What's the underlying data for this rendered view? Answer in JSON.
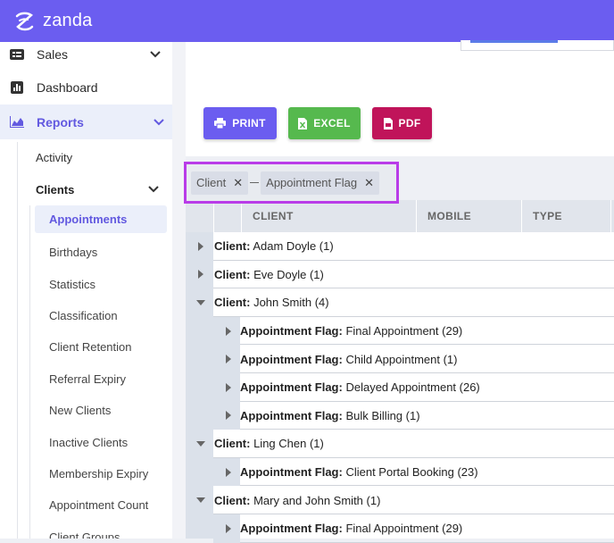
{
  "app": {
    "brand": "zanda"
  },
  "sidebar": {
    "sales": "Sales",
    "dashboard": "Dashboard",
    "reports": "Reports",
    "activity": "Activity",
    "clients": "Clients",
    "client_items": [
      "Appointments",
      "Birthdays",
      "Statistics",
      "Classification",
      "Client Retention",
      "Referral Expiry",
      "New Clients",
      "Inactive Clients",
      "Membership Expiry",
      "Appointment Count",
      "Client Groups"
    ]
  },
  "toolbar": {
    "print": "PRINT",
    "excel": "EXCEL",
    "pdf": "PDF"
  },
  "grouping": {
    "chips": [
      "Client",
      "Appointment Flag"
    ]
  },
  "grid": {
    "columns": [
      "CLIENT",
      "MOBILE",
      "TYPE"
    ],
    "rows": [
      {
        "level": 1,
        "expanded": false,
        "key": "Client:",
        "value": "Adam Doyle (1)"
      },
      {
        "level": 1,
        "expanded": false,
        "key": "Client:",
        "value": "Eve Doyle (1)"
      },
      {
        "level": 1,
        "expanded": true,
        "key": "Client:",
        "value": "John Smith (4)"
      },
      {
        "level": 2,
        "expanded": false,
        "key": "Appointment Flag:",
        "value": "Final Appointment (29)"
      },
      {
        "level": 2,
        "expanded": false,
        "key": "Appointment Flag:",
        "value": "Child Appointment (1)"
      },
      {
        "level": 2,
        "expanded": false,
        "key": "Appointment Flag:",
        "value": "Delayed Appointment (26)"
      },
      {
        "level": 2,
        "expanded": false,
        "key": "Appointment Flag:",
        "value": "Bulk Billing (1)"
      },
      {
        "level": 1,
        "expanded": true,
        "key": "Client:",
        "value": "Ling Chen (1)"
      },
      {
        "level": 2,
        "expanded": false,
        "key": "Appointment Flag:",
        "value": "Client Portal Booking (23)"
      },
      {
        "level": 1,
        "expanded": true,
        "key": "Client:",
        "value": "Mary and John Smith (1)"
      },
      {
        "level": 2,
        "expanded": false,
        "key": "Appointment Flag:",
        "value": "Final Appointment (29)"
      }
    ]
  },
  "colors": {
    "brand": "#6b5df0",
    "excel": "#56b94e",
    "pdf": "#c0145a",
    "highlight": "#b93ce8",
    "active_text": "#6259e0"
  }
}
